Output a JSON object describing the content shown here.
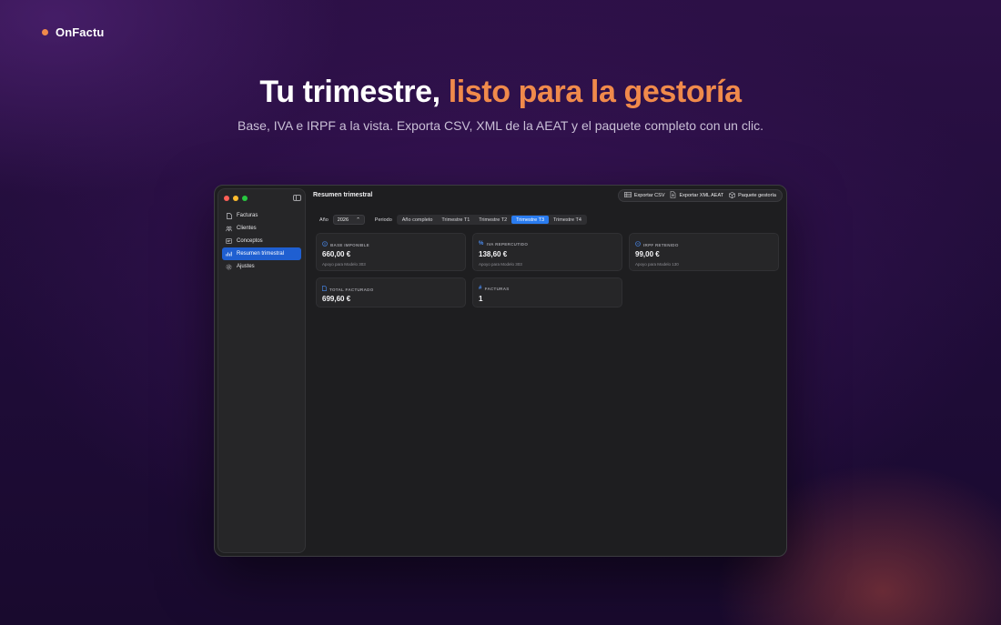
{
  "brand": {
    "name": "OnFactu"
  },
  "hero": {
    "title_main": "Tu trimestre,",
    "title_accent": "listo para la gestoría",
    "subtitle": "Base, IVA e IRPF a la vista. Exporta CSV, XML de la AEAT y el paquete completo con un clic."
  },
  "colors": {
    "accent": "#f08a4b",
    "selection": "#1f5fd1",
    "segment_active": "#2a7cf0"
  },
  "sidebar": {
    "items": [
      {
        "label": "Facturas",
        "icon": "document-icon"
      },
      {
        "label": "Clientes",
        "icon": "people-icon"
      },
      {
        "label": "Conceptos",
        "icon": "tag-list-icon"
      },
      {
        "label": "Resumen trimestral",
        "icon": "chart-icon",
        "active": true
      },
      {
        "label": "Ajustes",
        "icon": "gear-icon"
      }
    ]
  },
  "app": {
    "page_title": "Resumen trimestral",
    "toolbar": {
      "export_csv": "Exportar CSV",
      "export_xml": "Exportar XML AEAT",
      "package": "Paquete gestoría"
    },
    "filters": {
      "year_label": "Año",
      "year_value": "2026",
      "period_label": "Periodo",
      "periods": [
        "Año completo",
        "Trimestre T1",
        "Trimestre T2",
        "Trimestre T3",
        "Trimestre T4"
      ],
      "active_period": "Trimestre T3"
    },
    "cards": [
      {
        "title": "BASE IMPONIBLE",
        "value": "660,00 €",
        "note": "Apoyo para Modelo 303"
      },
      {
        "title": "IVA REPERCUTIDO",
        "value": "138,60 €",
        "note": "Apoyo para Modelo 303"
      },
      {
        "title": "IRPF RETENIDO",
        "value": "99,00 €",
        "note": "Apoyo para Modelo 130"
      },
      {
        "title": "TOTAL FACTURADO",
        "value": "699,60 €",
        "note": ""
      },
      {
        "title": "FACTURAS",
        "value": "1",
        "note": ""
      }
    ]
  }
}
